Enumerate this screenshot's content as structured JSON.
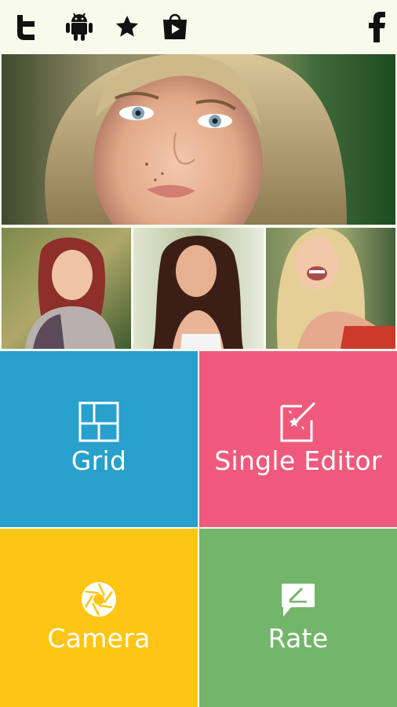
{
  "app": {
    "colors": {
      "top_bar": "#f8faeb",
      "grid_tile": "#27a0cc",
      "editor_tile": "#ef5a7c",
      "camera_tile": "#fdc615",
      "rate_tile": "#73b56a",
      "icon": "#111111"
    }
  },
  "topbar": {
    "icons": [
      "twitter-icon",
      "android-icon",
      "star-icon",
      "play-store-icon",
      "facebook-icon"
    ]
  },
  "gallery": {
    "photos": [
      "hero-photo",
      "photo-1",
      "photo-2",
      "photo-3"
    ]
  },
  "menu": {
    "grid": {
      "label": "Grid",
      "icon": "grid-layout-icon"
    },
    "single_editor": {
      "label": "Single Editor",
      "icon": "magic-edit-icon"
    },
    "camera": {
      "label": "Camera",
      "icon": "aperture-icon"
    },
    "rate": {
      "label": "Rate",
      "icon": "rate-pencil-icon"
    }
  }
}
